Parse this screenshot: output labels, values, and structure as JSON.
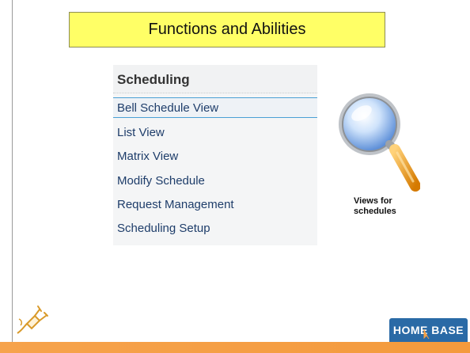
{
  "slide": {
    "title": "Functions and Abilities"
  },
  "menu": {
    "header": "Scheduling",
    "items": [
      {
        "label": "Bell Schedule View",
        "selected": true
      },
      {
        "label": "List View",
        "selected": false
      },
      {
        "label": "Matrix View",
        "selected": false
      },
      {
        "label": "Modify Schedule",
        "selected": false
      },
      {
        "label": "Request Management",
        "selected": false
      },
      {
        "label": "Scheduling Setup",
        "selected": false
      }
    ]
  },
  "callout": {
    "line1": "Views for",
    "line2": "schedules"
  },
  "icons": {
    "magnifier": "magnifying-glass-icon",
    "plug": "power-plug-icon"
  },
  "logo": {
    "text": "HOME BASE"
  },
  "colors": {
    "title_fill": "#ffff66",
    "menu_link": "#1e3d6a",
    "selection_border": "#4aa0d5",
    "footer_orange": "#f5a044",
    "logo_blue": "#2a6aa6"
  }
}
